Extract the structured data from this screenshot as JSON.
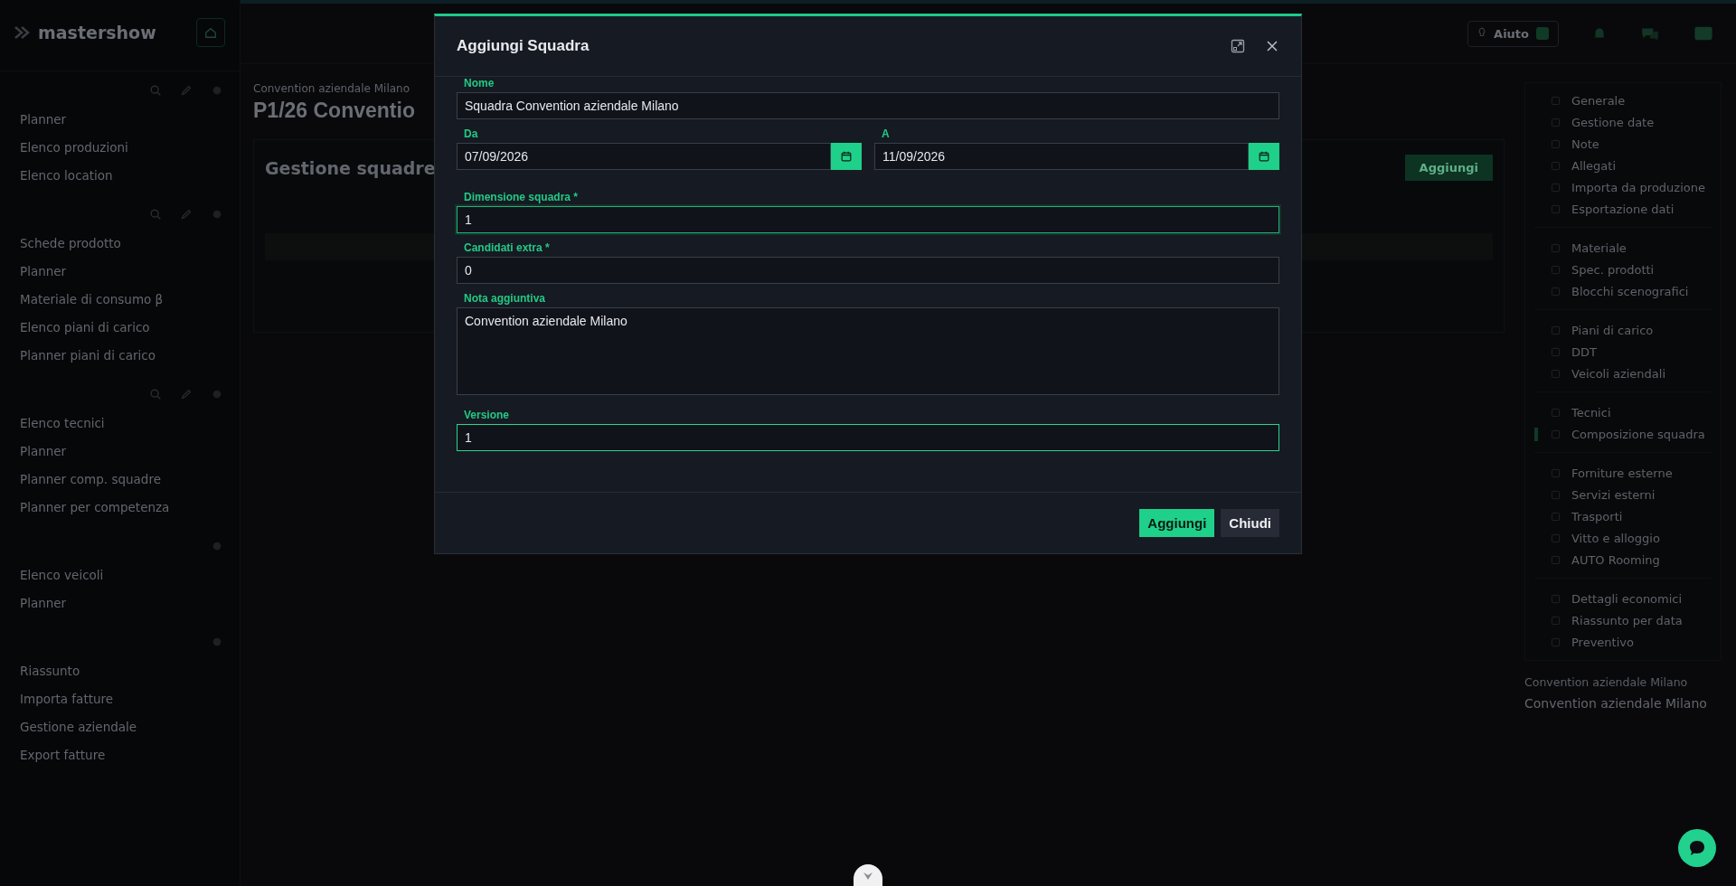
{
  "sidebar": {
    "logo": "mastershow",
    "groups": [
      {
        "items": [
          "Planner",
          "Elenco produzioni",
          "Elenco location"
        ]
      },
      {
        "items": [
          "Schede prodotto",
          "Planner",
          "Materiale di consumo β",
          "Elenco piani di carico",
          "Planner piani di carico"
        ]
      },
      {
        "items": [
          "Elenco tecnici",
          "Planner",
          "Planner comp. squadre",
          "Planner per competenza"
        ]
      },
      {
        "items": [
          "Elenco veicoli",
          "Planner"
        ]
      },
      {
        "items": [
          "Riassunto",
          "Importa fatture",
          "Gestione aziendale",
          "Export fatture"
        ]
      }
    ]
  },
  "topbar": {
    "help_button": "Aiuto"
  },
  "page": {
    "subtitle": "Convention aziendale Milano",
    "title": "P1/26 Conventio",
    "section_title": "Gestione squadre",
    "add_button": "Aggiungi"
  },
  "right_nav": {
    "sections": [
      {
        "items": [
          {
            "label": "Generale",
            "selected": false
          },
          {
            "label": "Gestione date",
            "selected": false
          },
          {
            "label": "Note",
            "selected": false
          },
          {
            "label": "Allegati",
            "selected": false
          },
          {
            "label": "Importa da produzione",
            "selected": false
          },
          {
            "label": "Esportazione dati",
            "selected": false
          }
        ]
      },
      {
        "items": [
          {
            "label": "Materiale",
            "selected": false
          },
          {
            "label": "Spec. prodotti",
            "selected": false
          },
          {
            "label": "Blocchi scenografici",
            "selected": false
          }
        ]
      },
      {
        "items": [
          {
            "label": "Piani di carico",
            "selected": false
          },
          {
            "label": "DDT",
            "selected": false
          },
          {
            "label": "Veicoli aziendali",
            "selected": false
          }
        ]
      },
      {
        "items": [
          {
            "label": "Tecnici",
            "selected": false
          },
          {
            "label": "Composizione squadra",
            "selected": true
          }
        ]
      },
      {
        "items": [
          {
            "label": "Forniture esterne",
            "selected": false
          },
          {
            "label": "Servizi esterni",
            "selected": false
          },
          {
            "label": "Trasporti",
            "selected": false
          },
          {
            "label": "Vitto e alloggio",
            "selected": false
          },
          {
            "label": "AUTO Rooming",
            "selected": false
          }
        ]
      },
      {
        "items": [
          {
            "label": "Dettagli economici",
            "selected": false
          },
          {
            "label": "Riassunto per data",
            "selected": false
          },
          {
            "label": "Preventivo",
            "selected": false
          }
        ]
      }
    ],
    "footer_title": "Convention aziendale Milano",
    "footer_value": "Convention aziendale Milano"
  },
  "dialog": {
    "title": "Aggiungi Squadra",
    "rows": [
      [
        {
          "kind": "text",
          "label": "Nome",
          "value": "Squadra Convention aziendale Milano",
          "focused": false,
          "valid": false
        }
      ],
      [
        {
          "kind": "date",
          "label": "Da",
          "value": "07/09/2026",
          "focused": false,
          "valid": false
        },
        {
          "kind": "date",
          "label": "A",
          "value": "11/09/2026",
          "focused": false,
          "valid": false
        }
      ],
      [
        {
          "kind": "text",
          "label": "Dimensione squadra *",
          "value": "1",
          "focused": true,
          "valid": false
        }
      ],
      [
        {
          "kind": "text",
          "label": "Candidati extra *",
          "value": "0",
          "focused": false,
          "valid": false
        }
      ],
      [
        {
          "kind": "textarea",
          "label": "Nota aggiuntiva",
          "value": "Convention aziendale Milano",
          "focused": false,
          "valid": false
        }
      ],
      [
        {
          "kind": "text",
          "label": "Versione",
          "value": "1",
          "focused": false,
          "valid": true
        }
      ]
    ],
    "buttons": [
      {
        "label": "Aggiungi",
        "kind": "primary"
      },
      {
        "label": "Chiudi",
        "kind": "secondary"
      }
    ]
  }
}
